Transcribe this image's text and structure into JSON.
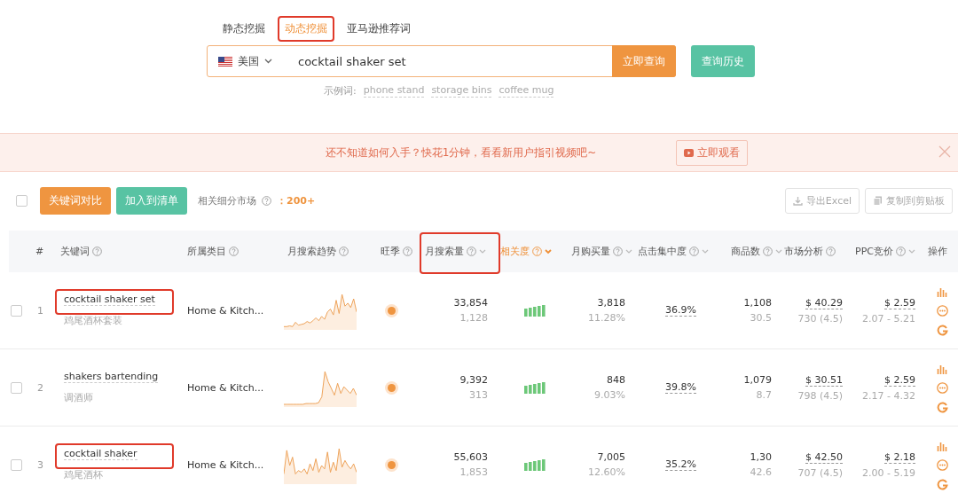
{
  "mode_tabs": [
    {
      "label": "静态挖掘",
      "selected": false,
      "annotated": false
    },
    {
      "label": "动态挖掘",
      "selected": true,
      "annotated": true
    },
    {
      "label": "亚马逊推荐词",
      "selected": false,
      "annotated": false
    }
  ],
  "search": {
    "country": "美国",
    "value": "cocktail shaker set",
    "submit": "立即查询",
    "history": "查询历史"
  },
  "examples": {
    "label": "示例词:",
    "words": [
      "phone stand",
      "storage bins",
      "coffee mug"
    ]
  },
  "banner": {
    "text": "还不知道如何入手？快花1分钟，看看新用户指引视频吧~",
    "button": "立即观看"
  },
  "toolbar": {
    "select_all": false,
    "compare": "关键词对比",
    "add_to_list": "加入到清单",
    "related_label": "相关细分市场",
    "related_count": "：200+",
    "export": "导出Excel",
    "copy": "复制到剪贴板"
  },
  "table": {
    "columns": [
      {
        "label": "#",
        "kind": "plain",
        "active": false,
        "annotated": false
      },
      {
        "label": "关键词",
        "kind": "help",
        "active": false,
        "annotated": false
      },
      {
        "label": "所属类目",
        "kind": "help",
        "active": false,
        "annotated": false
      },
      {
        "label": "月搜索趋势",
        "kind": "help",
        "active": false,
        "annotated": false
      },
      {
        "label": "旺季",
        "kind": "help",
        "active": false,
        "annotated": false
      },
      {
        "label": "月搜索量",
        "kind": "sortable",
        "active": false,
        "annotated": true
      },
      {
        "label": "相关度",
        "kind": "sortable",
        "active": true,
        "annotated": false
      },
      {
        "label": "月购买量",
        "kind": "sortable",
        "active": false,
        "annotated": false
      },
      {
        "label": "点击集中度",
        "kind": "sortable",
        "active": false,
        "annotated": false
      },
      {
        "label": "商品数",
        "kind": "sortable",
        "active": false,
        "annotated": false
      },
      {
        "label": "市场分析",
        "kind": "help",
        "active": false,
        "annotated": false
      },
      {
        "label": "PPC竞价",
        "kind": "sortable",
        "active": false,
        "annotated": false
      },
      {
        "label": "操作",
        "kind": "plain",
        "active": false,
        "annotated": false
      }
    ],
    "rows": [
      {
        "checked": false,
        "index": "1",
        "keyword": "cocktail shaker set",
        "translation": "鸡尾酒杯套装",
        "annotated": true,
        "category": "Home & Kitch...",
        "season": true,
        "search_volume": "33,854",
        "search_sub": "1,128",
        "relevance": {
          "level": 1
        },
        "purchases": "3,818",
        "purchase_rate": "11.28%",
        "click_share": "36.9%",
        "products": "1,108",
        "products_sub": "30.5",
        "price": "$ 40.29",
        "price_sub": "730 (4.5)",
        "ppc": "$ 2.59",
        "ppc_range": "2.07 - 5.21"
      },
      {
        "checked": false,
        "index": "2",
        "keyword": "shakers bartending",
        "translation": "调酒师",
        "annotated": false,
        "category": "Home & Kitch...",
        "season": true,
        "search_volume": "9,392",
        "search_sub": "313",
        "relevance": {
          "level": 1
        },
        "purchases": "848",
        "purchase_rate": "9.03%",
        "click_share": "39.8%",
        "products": "1,079",
        "products_sub": "8.7",
        "price": "$ 30.51",
        "price_sub": "798 (4.5)",
        "ppc": "$ 2.59",
        "ppc_range": "2.17 - 4.32"
      },
      {
        "checked": false,
        "index": "3",
        "keyword": "cocktail shaker",
        "translation": "鸡尾酒杯",
        "annotated": true,
        "category": "Home & Kitch...",
        "season": true,
        "search_volume": "55,603",
        "search_sub": "1,853",
        "relevance": {
          "level": 1
        },
        "purchases": "7,005",
        "purchase_rate": "12.60%",
        "click_share": "35.2%",
        "products": "1,30",
        "products_sub": "42.6",
        "price": "$ 42.50",
        "price_sub": "707 (4.5)",
        "ppc": "$ 2.18",
        "ppc_range": "2.00 - 5.19"
      }
    ]
  }
}
